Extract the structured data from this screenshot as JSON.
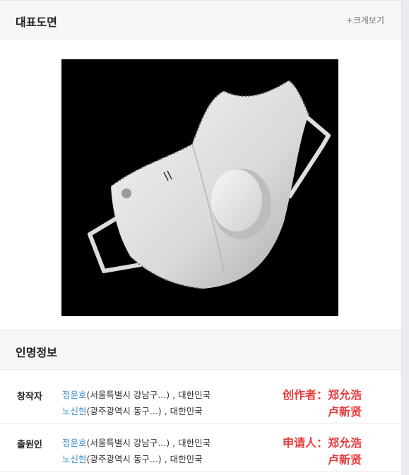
{
  "drawing_section": {
    "title": "대표도면",
    "enlarge_label": "+크게보기"
  },
  "inventor_section": {
    "title": "인명정보"
  },
  "rows": [
    {
      "label": "창작자",
      "people": [
        {
          "name": "정윤호",
          "detail": "(서울특별시 강남구...) , 대한민국"
        },
        {
          "name": "노신현",
          "detail": "(광주광역시 동구...) , 대한민국"
        }
      ],
      "cn_label": "创作者：郑允浩",
      "cn_name2": "卢新贤"
    },
    {
      "label": "출원인",
      "people": [
        {
          "name": "정윤호",
          "detail": "(서울특별시 강남구...) , 대한민국"
        },
        {
          "name": "노신현",
          "detail": "(광주광역시 동구...) , 대한민국"
        }
      ],
      "cn_label": "申请人：郑允浩",
      "cn_name2": "卢新贤"
    }
  ],
  "colors": {
    "link": "#3f8fc9",
    "annotation": "#e63c3c",
    "header_bg": "#f6f7f9"
  }
}
